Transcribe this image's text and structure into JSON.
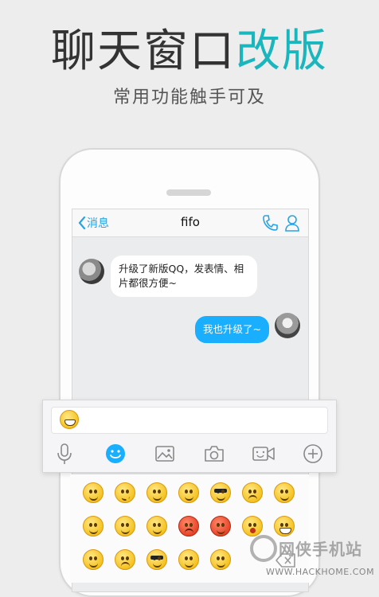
{
  "promo": {
    "title_main": "聊天窗口",
    "title_accent": "改版",
    "subtitle": "常用功能触手可及"
  },
  "chat": {
    "nav": {
      "back_label": "消息",
      "title": "fifo"
    },
    "messages": [
      {
        "side": "left",
        "text": "升级了新版QQ，发表情、相片都很方便~"
      },
      {
        "side": "right",
        "text": "我也升级了~"
      }
    ]
  },
  "input": {
    "draft_emoji": "grinning-emoji",
    "toolbar": [
      "microphone-icon",
      "emoji-icon",
      "image-icon",
      "camera-icon",
      "video-icon",
      "plus-icon"
    ],
    "accent_color": "#19aefe"
  },
  "emoji_panel": {
    "rows": 3,
    "columns": 7
  },
  "watermark": {
    "text": "网侠手机站",
    "url": "WWW.HACKHOME.COM"
  }
}
